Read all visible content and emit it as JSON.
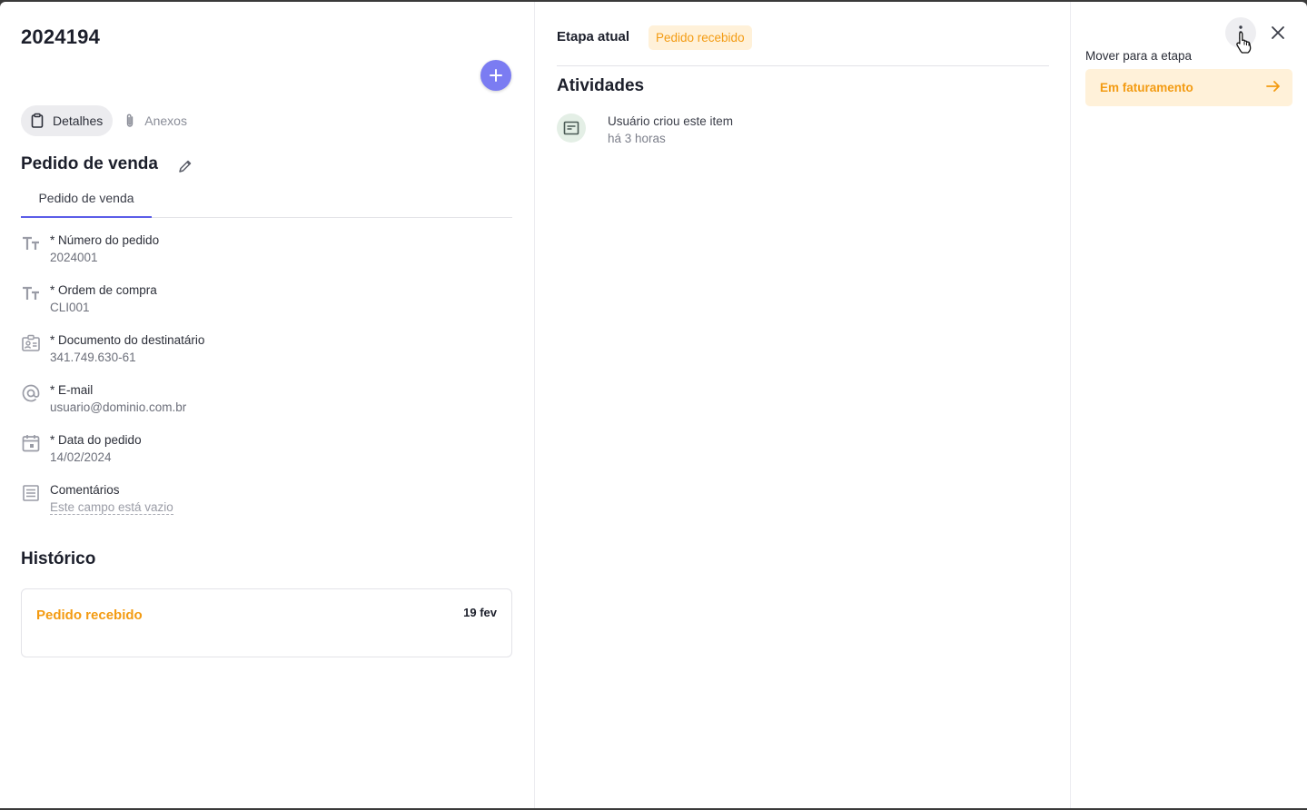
{
  "header": {
    "item_id": "2024194"
  },
  "tabs": [
    {
      "label": "Detalhes",
      "icon": "clipboard-icon"
    },
    {
      "label": "Anexos",
      "icon": "paperclip-icon"
    }
  ],
  "form": {
    "title": "Pedido de venda",
    "subtab": "Pedido de venda",
    "fields": [
      {
        "label": "* Número do pedido",
        "value": "2024001",
        "icon": "text-type-icon"
      },
      {
        "label": "* Ordem de compra",
        "value": "CLI001",
        "icon": "text-type-icon"
      },
      {
        "label": "* Documento do destinatário",
        "value": "341.749.630-61",
        "icon": "id-card-icon"
      },
      {
        "label": "* E-mail",
        "value": "usuario@dominio.com.br",
        "icon": "at-sign-icon"
      },
      {
        "label": "* Data do pedido",
        "value": "14/02/2024",
        "icon": "calendar-icon"
      },
      {
        "label": "Comentários",
        "value": "Este campo está vazio",
        "icon": "long-text-icon"
      }
    ]
  },
  "history": {
    "title": "Histórico",
    "entries": [
      {
        "stage": "Pedido recebido",
        "date": "19 fev"
      }
    ]
  },
  "stage": {
    "label": "Etapa atual",
    "current": "Pedido recebido"
  },
  "activities": {
    "title": "Atividades",
    "items": [
      {
        "text": "Usuário criou este item",
        "time": "há 3 horas",
        "icon": "card-icon"
      }
    ]
  },
  "move": {
    "label": "Mover para a etapa",
    "target": "Em faturamento"
  },
  "colors": {
    "accent": "#7b7cf2",
    "tab_underline": "#5b5de8",
    "stage_orange": "#f39b12",
    "stage_bg": "#fff1d9"
  }
}
